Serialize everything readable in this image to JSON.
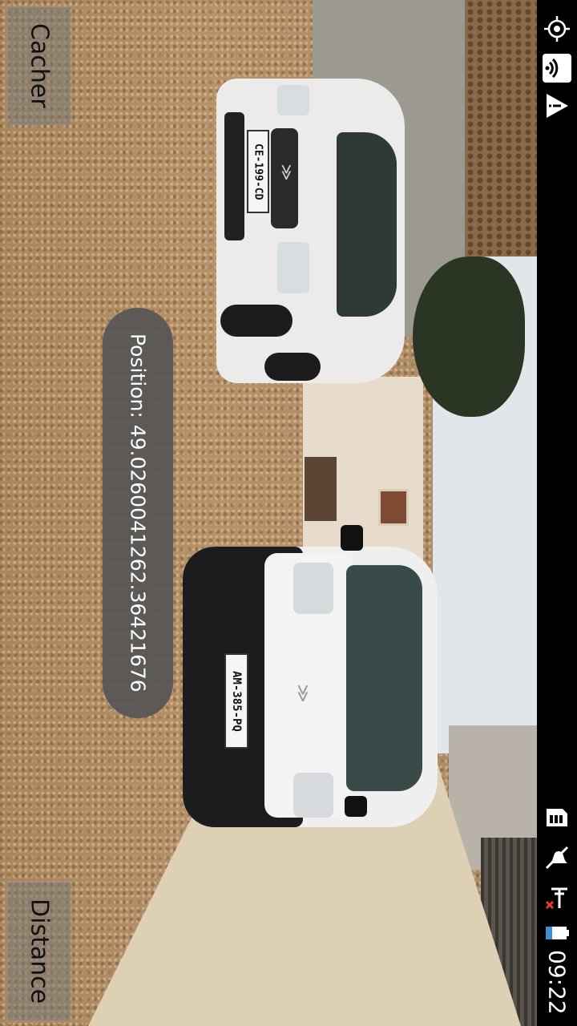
{
  "buttons": {
    "hide_label": "Cacher",
    "distance_label": "Distance"
  },
  "toast": {
    "position_text": "Position: 49.0260041262.36421676"
  },
  "camera_preview": {
    "plate_top_van": "CE-199-CD",
    "plate_bottom_van": "AM-385-PQ"
  },
  "status_bar": {
    "time": "09:22",
    "icons": [
      "gps-icon",
      "wifi-icon",
      "warning-icon",
      "sim-card-icon",
      "muted-icon",
      "no-signal-icon",
      "battery-icon"
    ]
  }
}
